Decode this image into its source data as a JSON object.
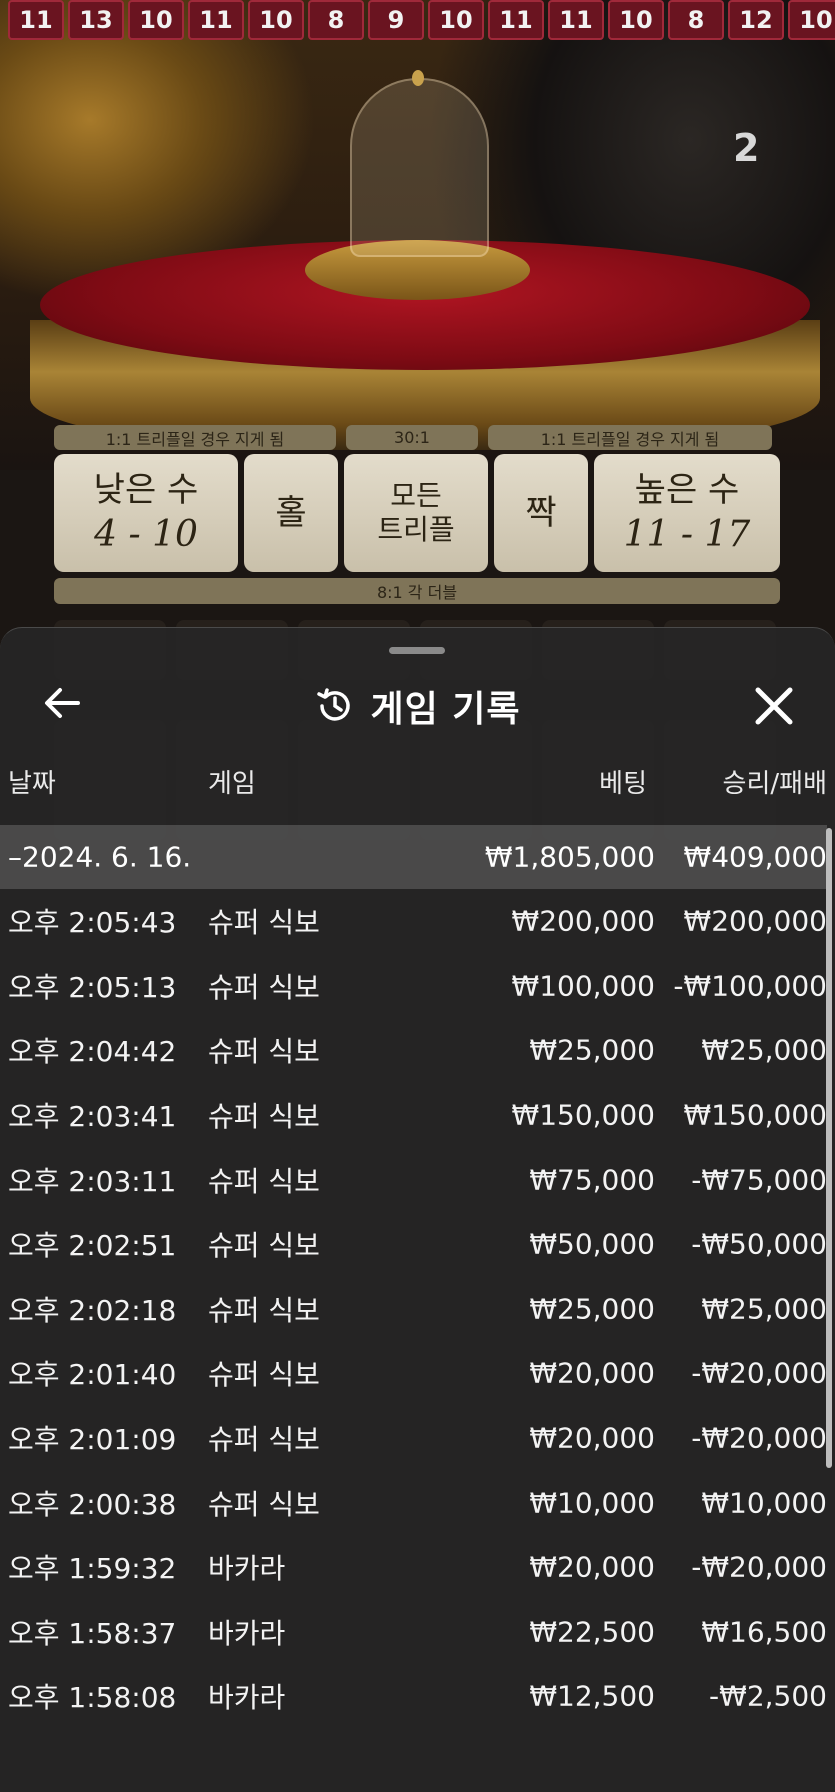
{
  "history_numbers": [
    "11",
    "13",
    "10",
    "11",
    "10",
    "8",
    "9",
    "10",
    "11",
    "11",
    "10",
    "8",
    "12",
    "10"
  ],
  "dealer_number": "2",
  "board": {
    "payouts_top": [
      "1:1 트리플일 경우 지게 됨",
      "30:1",
      "1:1 트리플일 경우 지게 됨"
    ],
    "bets": [
      {
        "label": "낮은 수",
        "sub": "4 - 10"
      },
      {
        "label": "홀",
        "sub": ""
      },
      {
        "label": "모든\n트리플",
        "sub": ""
      },
      {
        "label": "짝",
        "sub": ""
      },
      {
        "label": "높은 수",
        "sub": "11 - 17"
      }
    ],
    "double_label": "8:1 각 더블"
  },
  "sheet": {
    "title": "게임 기록",
    "columns": {
      "date": "날짜",
      "game": "게임",
      "bet": "베팅",
      "win": "승리/패배"
    },
    "date_group": {
      "date": "–2024. 6. 16.",
      "bet_total": "₩1,805,000",
      "win_total": "₩409,000"
    },
    "rows": [
      {
        "time": "오후 2:05:43",
        "game": "슈퍼 식보",
        "bet": "₩200,000",
        "win": "₩200,000"
      },
      {
        "time": "오후 2:05:13",
        "game": "슈퍼 식보",
        "bet": "₩100,000",
        "win": "-₩100,000"
      },
      {
        "time": "오후 2:04:42",
        "game": "슈퍼 식보",
        "bet": "₩25,000",
        "win": "₩25,000"
      },
      {
        "time": "오후 2:03:41",
        "game": "슈퍼 식보",
        "bet": "₩150,000",
        "win": "₩150,000"
      },
      {
        "time": "오후 2:03:11",
        "game": "슈퍼 식보",
        "bet": "₩75,000",
        "win": "-₩75,000"
      },
      {
        "time": "오후 2:02:51",
        "game": "슈퍼 식보",
        "bet": "₩50,000",
        "win": "-₩50,000"
      },
      {
        "time": "오후 2:02:18",
        "game": "슈퍼 식보",
        "bet": "₩25,000",
        "win": "₩25,000"
      },
      {
        "time": "오후 2:01:40",
        "game": "슈퍼 식보",
        "bet": "₩20,000",
        "win": "-₩20,000"
      },
      {
        "time": "오후 2:01:09",
        "game": "슈퍼 식보",
        "bet": "₩20,000",
        "win": "-₩20,000"
      },
      {
        "time": "오후 2:00:38",
        "game": "슈퍼 식보",
        "bet": "₩10,000",
        "win": "₩10,000"
      },
      {
        "time": "오후 1:59:32",
        "game": "바카라",
        "bet": "₩20,000",
        "win": "-₩20,000"
      },
      {
        "time": "오후 1:58:37",
        "game": "바카라",
        "bet": "₩22,500",
        "win": "₩16,500"
      },
      {
        "time": "오후 1:58:08",
        "game": "바카라",
        "bet": "₩12,500",
        "win": "-₩2,500"
      }
    ]
  },
  "icons": {
    "back": "arrow-left-icon",
    "history": "history-icon",
    "close": "close-icon"
  }
}
